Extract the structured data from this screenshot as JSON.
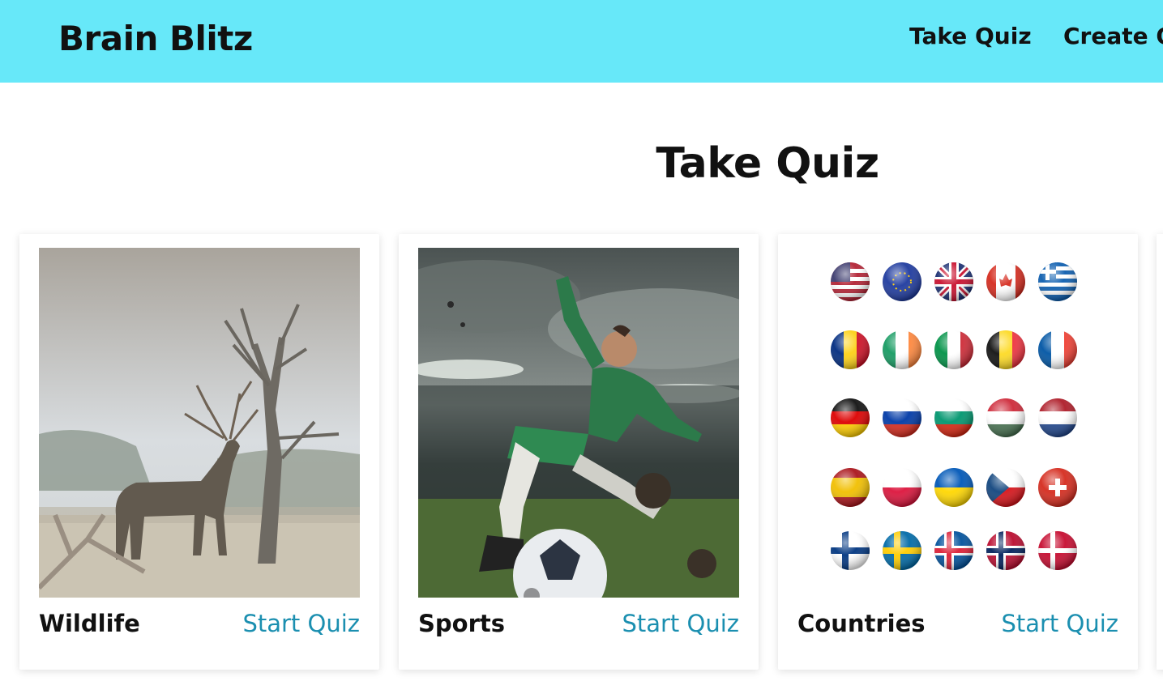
{
  "navbar": {
    "brand": "Brain Blitz",
    "links": [
      "Take Quiz",
      "Create Quiz"
    ],
    "bg_color": "#67e8f9"
  },
  "page": {
    "title": "Take Quiz"
  },
  "quizzes": [
    {
      "name": "Wildlife",
      "action": "Start Quiz",
      "image": "deer-tree-icon"
    },
    {
      "name": "Sports",
      "action": "Start Quiz",
      "image": "soccer-player-icon"
    },
    {
      "name": "Countries",
      "action": "Start Quiz",
      "image": "flag-balls-icon"
    }
  ],
  "colors": {
    "accent_link": "#1b8fb0"
  }
}
